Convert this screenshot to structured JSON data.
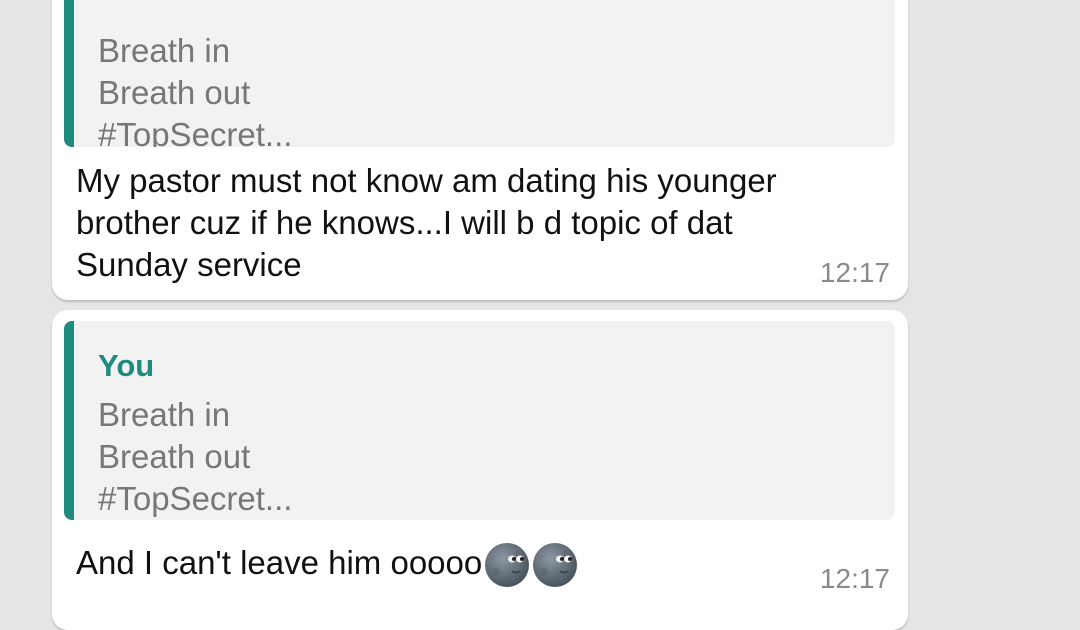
{
  "messages": [
    {
      "quote": {
        "sender": "",
        "lines": [
          "Breath in",
          "Breath out",
          "#TopSecret..."
        ]
      },
      "text_lines": [
        "My pastor must not know am dating his younger",
        "brother cuz if he knows...I will b d topic of dat",
        "Sunday service"
      ],
      "time": "12:17"
    },
    {
      "quote": {
        "sender": "You",
        "lines": [
          "Breath in",
          "Breath out",
          "#TopSecret..."
        ]
      },
      "text": "And I can't leave him ooooo",
      "emojis": [
        "new-moon-face-emoji",
        "new-moon-face-emoji"
      ],
      "time": "12:17"
    }
  ],
  "colors": {
    "background": "#e5e5e5",
    "bubble": "#ffffff",
    "quote_background": "#f2f2f2",
    "quote_accent": "#1f8a7e",
    "quote_text": "#777777",
    "message_text": "#111111",
    "timestamp": "#8a8a8a"
  }
}
